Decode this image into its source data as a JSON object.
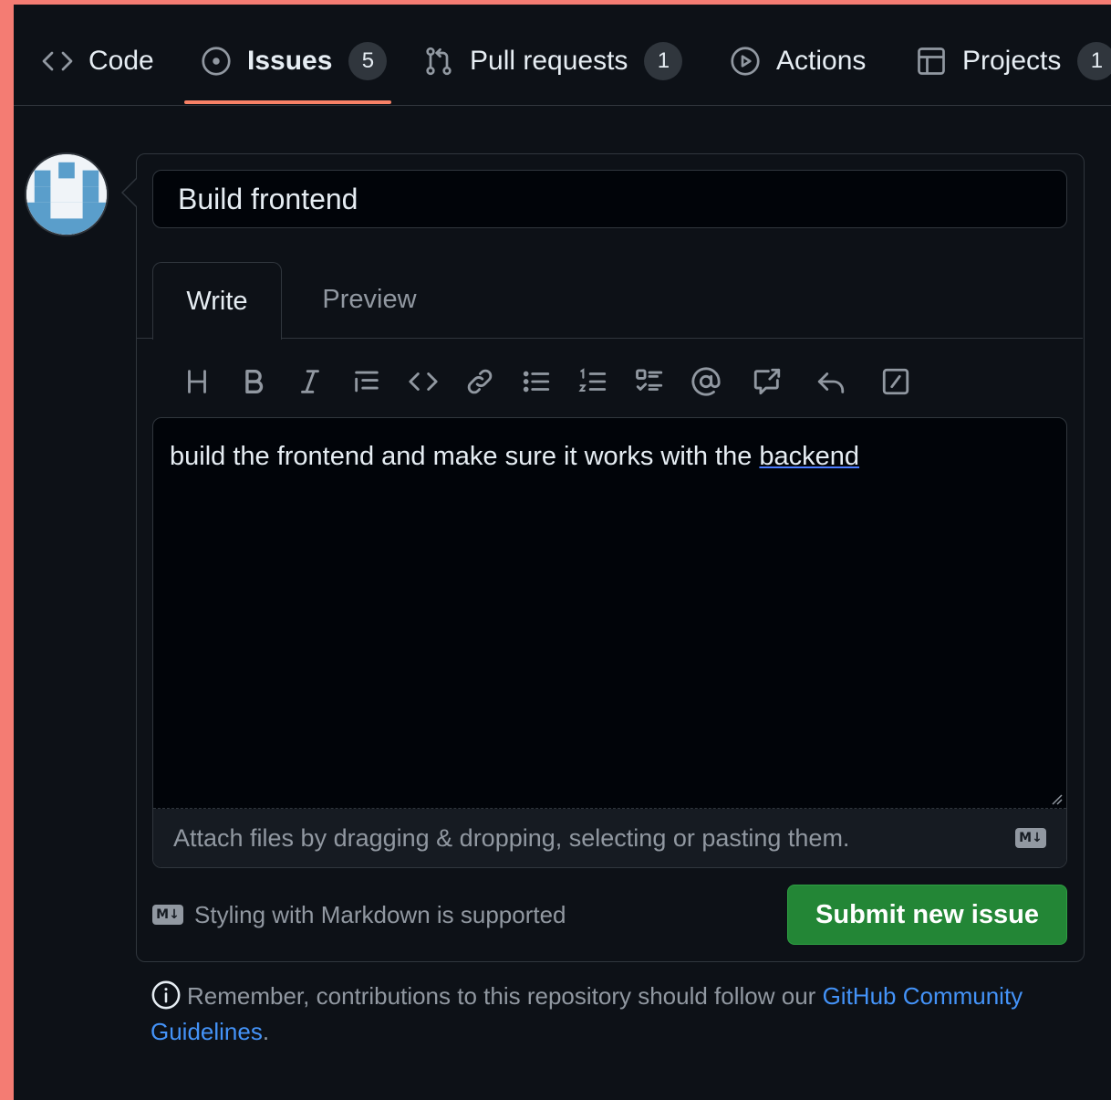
{
  "nav": {
    "items": [
      {
        "label": "Code",
        "icon": "code-icon"
      },
      {
        "label": "Issues",
        "icon": "issue-opened-icon",
        "count": "5",
        "active": true
      },
      {
        "label": "Pull requests",
        "icon": "git-pull-request-icon",
        "count": "1"
      },
      {
        "label": "Actions",
        "icon": "play-icon"
      },
      {
        "label": "Projects",
        "icon": "table-icon",
        "count": "1"
      }
    ]
  },
  "issue_form": {
    "title_value": "Build frontend",
    "tabs": [
      {
        "label": "Write",
        "active": true
      },
      {
        "label": "Preview"
      }
    ],
    "toolbar": [
      "heading-icon",
      "bold-icon",
      "italic-icon",
      "quote-icon",
      "code-icon",
      "link-icon",
      "unordered-list-icon",
      "ordered-list-icon",
      "task-list-icon",
      "mention-icon",
      "cross-reference-icon",
      "reply-icon",
      "slash-commands-icon"
    ],
    "body_text_before": "build the frontend and make sure it works with the ",
    "body_text_flagged": "backend",
    "attach_text": "Attach files by dragging & dropping, selecting or pasting them.",
    "markdown_hint": "Styling with Markdown is supported",
    "markdown_badge": "M↓",
    "submit_label": "Submit new issue"
  },
  "notice": {
    "text": "Remember, contributions to this repository should follow our ",
    "link": "GitHub Community Guidelines",
    "suffix": "."
  },
  "colors": {
    "background": "#0d1117",
    "accent_underline": "#f78166",
    "submit_button": "#238636",
    "link": "#4493f8",
    "outer_border": "#f47c73"
  }
}
